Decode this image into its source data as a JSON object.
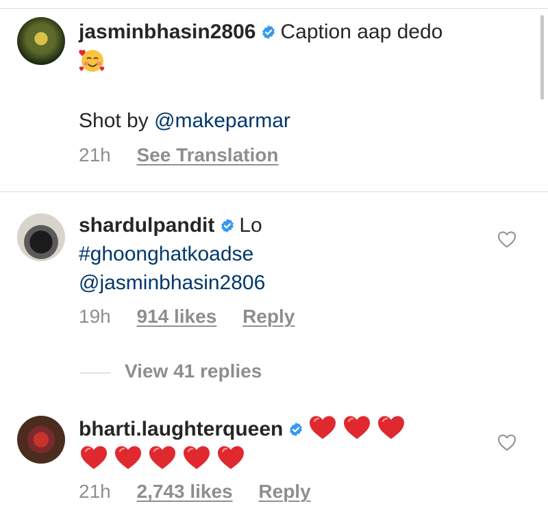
{
  "comments": [
    {
      "username": "jasminbhasin2806",
      "text": "Caption aap dedo",
      "shot_by_prefix": "Shot by ",
      "mention": "@makeparmar",
      "time": "21h",
      "see_translation": "See Translation"
    },
    {
      "username": "shardulpandit",
      "text": "Lo",
      "hashtag": "#ghoonghatkoadse",
      "mention": "@jasminbhasin2806",
      "time": "19h",
      "likes": "914 likes",
      "reply": "Reply",
      "view_replies": "View 41 replies"
    },
    {
      "username": "bharti.laughterqueen",
      "hearts_line1": 3,
      "hearts_line2": 5,
      "time": "21h",
      "likes": "2,743 likes",
      "reply": "Reply"
    }
  ],
  "colors": {
    "verified": "#3897f0",
    "link": "#00376b",
    "meta": "#8e8e8e",
    "heart": "#e0292f"
  },
  "icons": [
    "verified-badge-icon",
    "heart-outline-icon",
    "smiling-face-with-hearts-icon",
    "red-heart-icon"
  ]
}
